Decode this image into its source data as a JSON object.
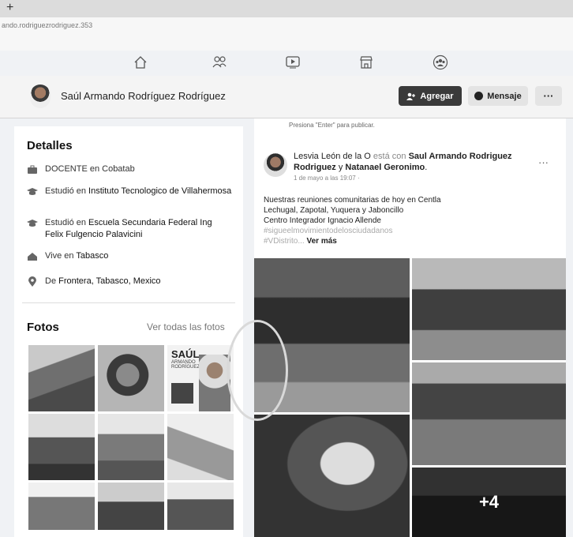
{
  "browser": {
    "new_tab_symbol": "+",
    "url": "ando.rodriguezrodriguez.353"
  },
  "nav": {
    "icons": [
      "home-icon",
      "friends-icon",
      "watch-icon",
      "marketplace-icon",
      "groups-icon"
    ]
  },
  "profile": {
    "name": "Saúl Armando Rodríguez Rodríguez",
    "add_label": "Agregar",
    "message_label": "Mensaje",
    "more_label": "···"
  },
  "composer_hint": "Presiona \"Enter\" para publicar.",
  "details": {
    "title": "Detalles",
    "items": [
      {
        "icon": "briefcase-icon",
        "prefix": "",
        "text": "DOCENTE en Cobatab"
      },
      {
        "icon": "graduation-cap-icon",
        "prefix": "Estudió en ",
        "text": "Instituto Tecnologico de Villahermosa"
      },
      {
        "icon": "graduation-cap-icon",
        "prefix": "Estudió en ",
        "text": "Escuela Secundaria Federal Ing Felix Fulgencio Palavicini"
      },
      {
        "icon": "home-icon",
        "prefix": "Vive en ",
        "text": "Tabasco"
      },
      {
        "icon": "location-pin-icon",
        "prefix": "De ",
        "text": "Frontera, Tabasco, Mexico"
      }
    ]
  },
  "photos": {
    "title": "Fotos",
    "see_all": "Ver todas las fotos",
    "poster_title": "SAÚL",
    "poster_sub": "ARMANDO RODRÍGUEZ"
  },
  "post": {
    "author": "Lesvia León de la O",
    "with_text": " está con ",
    "tagged1": "Saul Armando Rodriguez Rodriguez",
    "and_text": " y ",
    "tagged2": "Natanael Geronimo",
    "end": ".",
    "time": "1 de mayo a las 19:07 ·",
    "more_label": "···",
    "text_lines": [
      "Nuestras reuniones comunitarias de hoy en  Centla",
      "Lechugal, Zapotal, Yuquera y Jaboncillo",
      "Centro Integrador Ignacio Allende"
    ],
    "hashtag": "#sigueelmovimientodelosciudadanos",
    "hashtag2": "#VDistrito...",
    "see_more": "Ver más",
    "extra_photos": "+4"
  }
}
